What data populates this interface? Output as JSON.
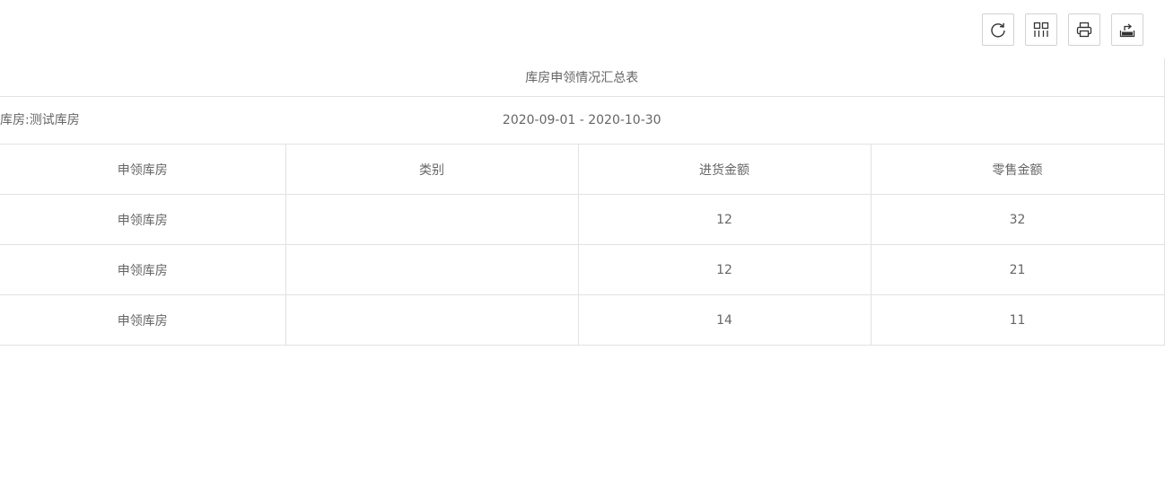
{
  "toolbar": {
    "buttons": [
      {
        "icon": "refresh-icon"
      },
      {
        "icon": "columns-icon"
      },
      {
        "icon": "print-icon"
      },
      {
        "icon": "export-icon"
      }
    ]
  },
  "report": {
    "title": "库房申领情况汇总表",
    "warehouse_label": "库房:测试库房",
    "date_range": "2020-09-01 - 2020-10-30",
    "headers": [
      "申领库房",
      "类别",
      "进货金额",
      "零售金额"
    ],
    "rows": [
      [
        "申领库房",
        "",
        "12",
        "32"
      ],
      [
        "申领库房",
        "",
        "12",
        "21"
      ],
      [
        "申领库房",
        "",
        "14",
        "11"
      ]
    ]
  }
}
